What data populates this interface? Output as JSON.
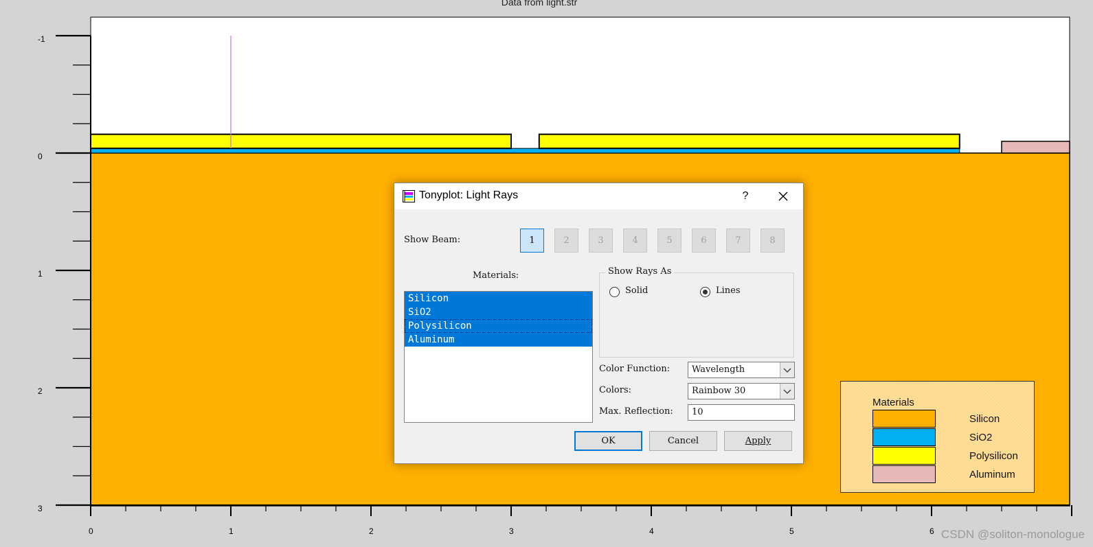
{
  "plot": {
    "title": "Data from light.str",
    "x_tick_labels": [
      "0",
      "1",
      "2",
      "3",
      "4",
      "5",
      "6"
    ],
    "y_tick_labels": [
      "-1",
      "0",
      "1",
      "2",
      "3"
    ],
    "material_colors": {
      "Silicon": "#ffb000",
      "SiO2": "#00b0f0",
      "Polysilicon": "#ffff00",
      "Aluminum": "#e6b8b8"
    },
    "ray_color": "#c070e0"
  },
  "legend": {
    "title": "Materials",
    "items": [
      {
        "label": "Silicon",
        "color": "#ffb000"
      },
      {
        "label": "SiO2",
        "color": "#00b0f0"
      },
      {
        "label": "Polysilicon",
        "color": "#ffff00"
      },
      {
        "label": "Aluminum",
        "color": "#e6b8b8"
      }
    ]
  },
  "dialog": {
    "title": "Tonyplot: Light Rays",
    "help": "?",
    "show_beam_label": "Show Beam:",
    "beams": [
      "1",
      "2",
      "3",
      "4",
      "5",
      "6",
      "7",
      "8"
    ],
    "active_beam": "1",
    "materials_label": "Materials:",
    "materials": [
      "Silicon",
      "SiO2",
      "Polysilicon",
      "Aluminum"
    ],
    "show_rays_as": {
      "title": "Show Rays As",
      "options": [
        "Solid",
        "Lines"
      ],
      "selected": "Lines"
    },
    "color_function": {
      "label": "Color Function:",
      "value": "Wavelength"
    },
    "colors": {
      "label": "Colors:",
      "value": "Rainbow 30"
    },
    "max_reflection": {
      "label": "Max. Reflection:",
      "value": "10"
    },
    "buttons": {
      "ok": "OK",
      "cancel": "Cancel",
      "apply": "Apply"
    }
  },
  "watermark": "CSDN @soliton-monologue"
}
